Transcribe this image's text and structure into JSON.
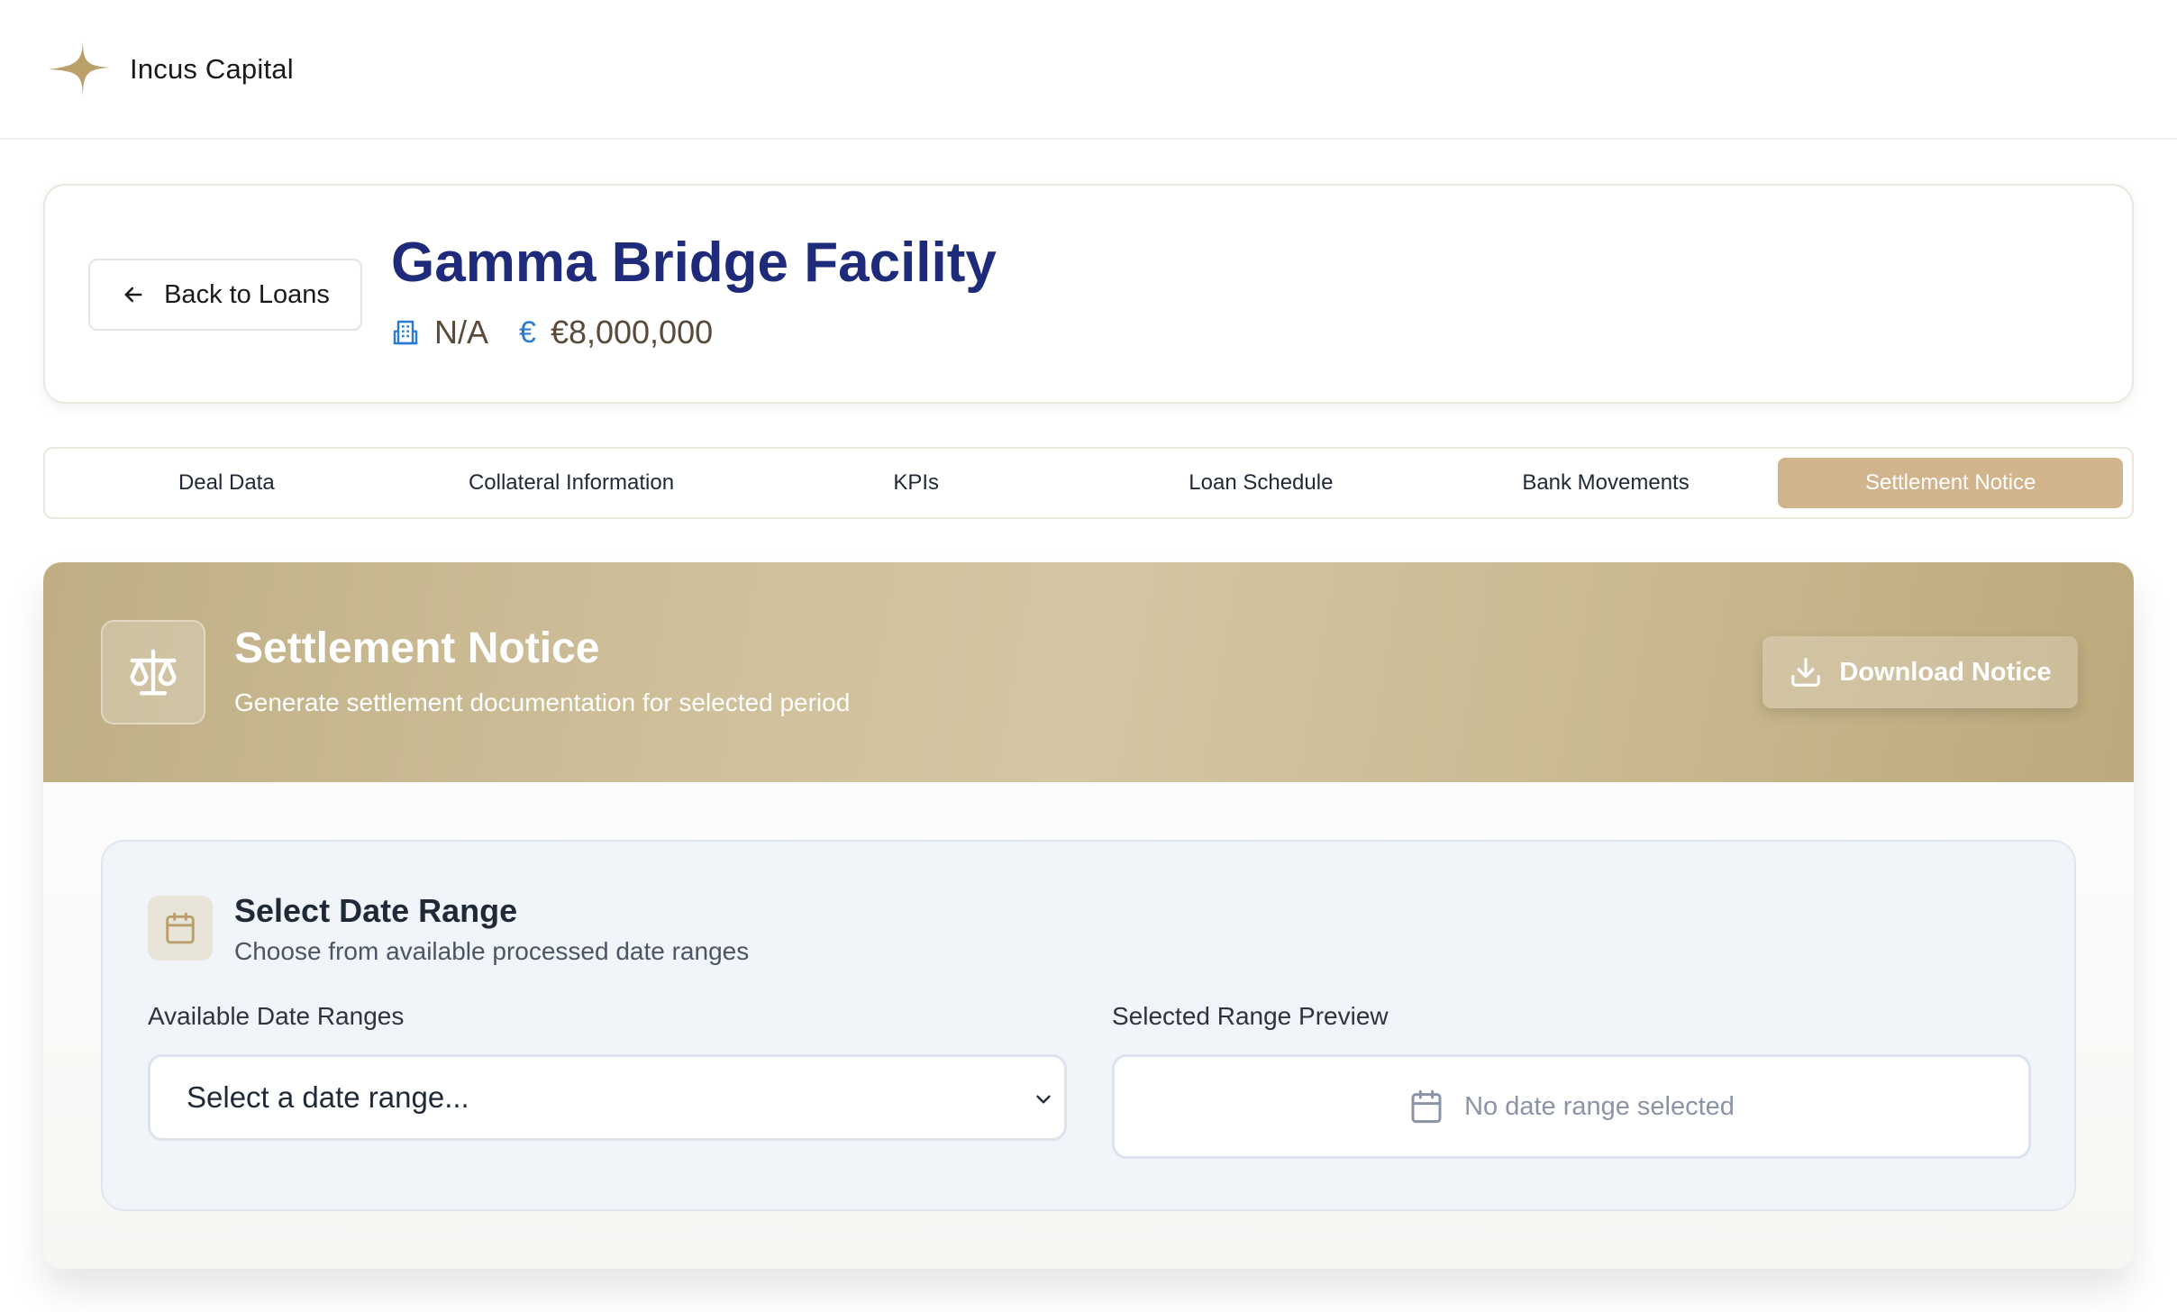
{
  "brand": {
    "name": "Incus Capital"
  },
  "header": {
    "back_label": "Back to Loans",
    "title": "Gamma Bridge Facility",
    "borrower": "N/A",
    "amount": "€8,000,000",
    "currency_symbol": "€"
  },
  "tabs": [
    {
      "label": "Deal Data",
      "active": false
    },
    {
      "label": "Collateral Information",
      "active": false
    },
    {
      "label": "KPIs",
      "active": false
    },
    {
      "label": "Loan Schedule",
      "active": false
    },
    {
      "label": "Bank Movements",
      "active": false
    },
    {
      "label": "Settlement Notice",
      "active": true
    }
  ],
  "settlement": {
    "title": "Settlement Notice",
    "subtitle": "Generate settlement documentation for selected period",
    "download_label": "Download Notice",
    "range": {
      "title": "Select Date Range",
      "subtitle": "Choose from available processed date ranges",
      "available_label": "Available Date Ranges",
      "select_value": "Select a date range...",
      "preview_label": "Selected Range Preview",
      "preview_empty": "No date range selected"
    }
  },
  "colors": {
    "accent": "#d2b48c",
    "title_blue": "#1e2a7a",
    "header_gold": "#c9b88e"
  },
  "icons": [
    "sparkle-logo-icon",
    "arrow-left-icon",
    "building-icon",
    "euro-icon",
    "scale-icon",
    "download-icon",
    "calendar-icon",
    "chevron-down-icon"
  ]
}
